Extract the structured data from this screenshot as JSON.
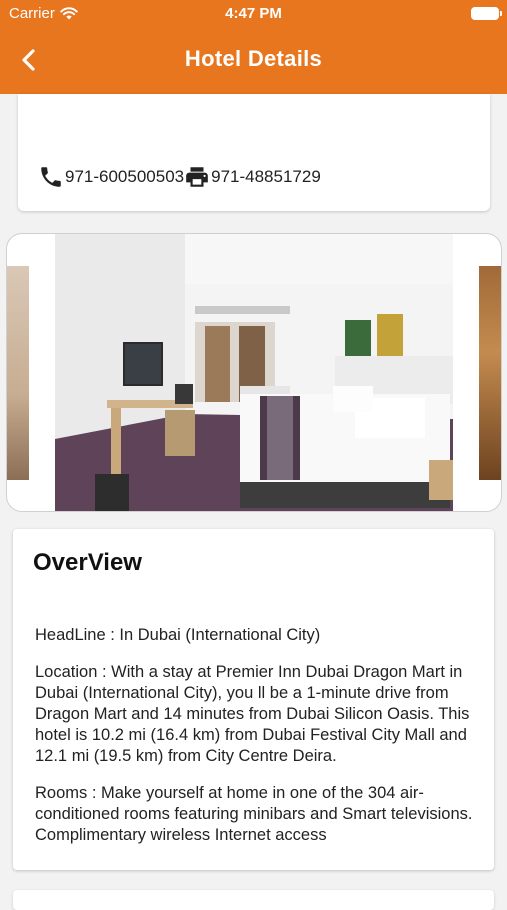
{
  "status_bar": {
    "carrier": "Carrier",
    "time": "4:47 PM"
  },
  "navbar": {
    "title": "Hotel Details"
  },
  "contact": {
    "phone": "971-600500503",
    "fax": "971-48851729"
  },
  "overview": {
    "heading": "OverView",
    "headline": "HeadLine : In Dubai (International City)",
    "location": "Location : With a stay at Premier Inn Dubai Dragon Mart in Dubai (International City), you ll be a 1-minute drive from Dragon Mart and 14 minutes from Dubai Silicon Oasis. This hotel is 10.2 mi (16.4 km) from Dubai Festival City Mall and 12.1 mi (19.5 km) from City Centre Deira.",
    "rooms": "Rooms : Make yourself at home in one of the 304 air-conditioned rooms featuring minibars and Smart televisions. Complimentary wireless Internet access"
  },
  "colors": {
    "accent": "#e8761e"
  },
  "icons": {
    "back": "chevron-left-icon",
    "phone": "phone-icon",
    "fax": "printer-icon",
    "wifi": "wifi-icon",
    "battery": "battery-icon"
  }
}
